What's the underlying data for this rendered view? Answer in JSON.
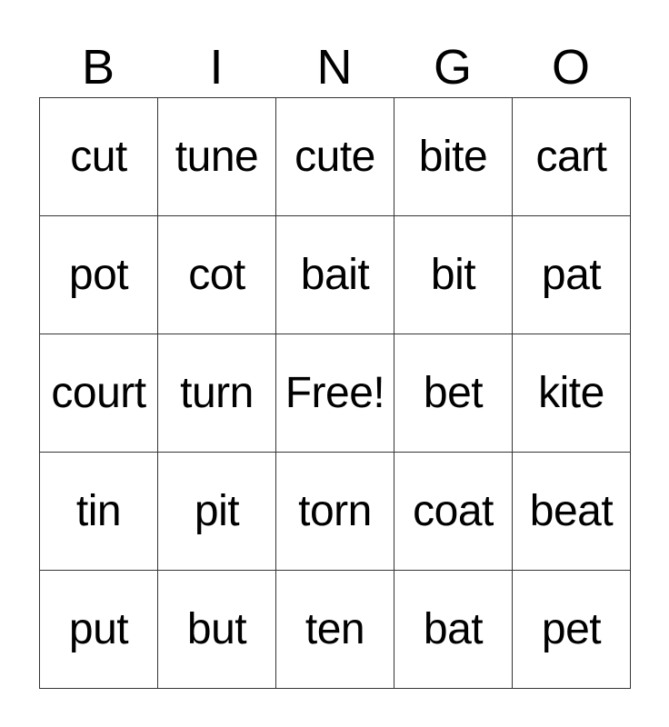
{
  "header": [
    "B",
    "I",
    "N",
    "G",
    "O"
  ],
  "grid": [
    [
      "cut",
      "tune",
      "cute",
      "bite",
      "cart"
    ],
    [
      "pot",
      "cot",
      "bait",
      "bit",
      "pat"
    ],
    [
      "court",
      "turn",
      "Free!",
      "bet",
      "kite"
    ],
    [
      "tin",
      "pit",
      "torn",
      "coat",
      "beat"
    ],
    [
      "put",
      "but",
      "ten",
      "bat",
      "pet"
    ]
  ]
}
